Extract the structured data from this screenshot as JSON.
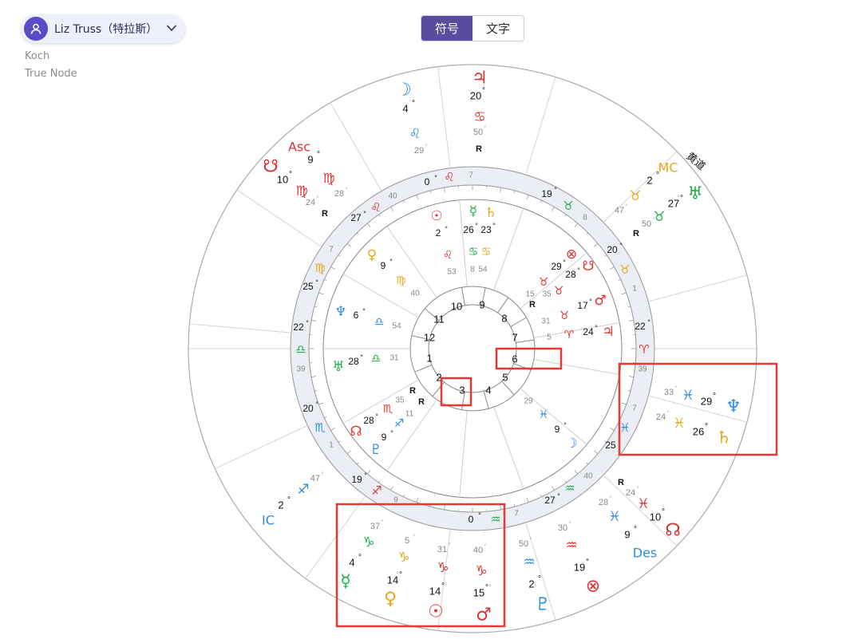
{
  "header": {
    "person_name": "Liz Truss（特拉斯）",
    "house_system": "Koch",
    "node_type": "True Node",
    "toggle": [
      {
        "label": "符号",
        "active": true
      },
      {
        "label": "文字",
        "active": false
      }
    ]
  },
  "chart_labels": {
    "ecliptic": "黄道",
    "house_cusps": [
      "1",
      "2",
      "3",
      "4",
      "5",
      "6",
      "7",
      "8",
      "9",
      "10",
      "11",
      "12"
    ]
  },
  "colors": {
    "fire": "#e03030",
    "earth": "#e8a81a",
    "air": "#1fae4a",
    "water": "#2b8ee0",
    "highlight": "#e53935",
    "accent": "#5a4b9f"
  },
  "outer_planets": [
    {
      "name": "moon",
      "glyph": "☽",
      "deg": "4",
      "sign": "♌",
      "min": "29",
      "color": "#2b8ee0",
      "key": "o1"
    },
    {
      "name": "jupiter",
      "glyph": "♃",
      "deg": "20",
      "sign": "♋",
      "min": "50",
      "color": "#e03030",
      "retro": "R",
      "key": "o2"
    },
    {
      "name": "asc",
      "glyph": "Asc",
      "deg": "9",
      "sign": "♍",
      "min": "28",
      "color": "#e03030",
      "key": "o3"
    },
    {
      "name": "south-node",
      "glyph": "☋",
      "deg": "10",
      "sign": "♍",
      "min": "24",
      "color": "#e03030",
      "retro": "R",
      "key": "o4"
    },
    {
      "name": "mc",
      "glyph": "MC",
      "deg": "2",
      "sign": "♉",
      "min": "47",
      "color": "#e8a81a",
      "key": "o5"
    },
    {
      "name": "uranus",
      "glyph": "♅",
      "deg": "27",
      "sign": "♉",
      "min": "50",
      "color": "#1fae4a",
      "retro": "R",
      "key": "o6"
    },
    {
      "name": "neptune",
      "glyph": "♆",
      "deg": "29",
      "sign": "♓",
      "min": "33",
      "color": "#2b8ee0",
      "key": "o7"
    },
    {
      "name": "saturn",
      "glyph": "♄",
      "deg": "26",
      "sign": "♓",
      "min": "24",
      "color": "#e8a81a",
      "key": "o8"
    },
    {
      "name": "north-node",
      "glyph": "☊",
      "deg": "10",
      "sign": "♓",
      "min": "24",
      "color": "#e03030",
      "retro": "R",
      "key": "o9"
    },
    {
      "name": "des",
      "glyph": "Des",
      "deg": "9",
      "sign": "♓",
      "min": "28",
      "color": "#2b8ee0",
      "key": "o10"
    },
    {
      "name": "part-of-fortune",
      "glyph": "⊗",
      "deg": "19",
      "sign": "♒",
      "min": "30",
      "color": "#e03030",
      "key": "o11"
    },
    {
      "name": "pluto",
      "glyph": "♇",
      "deg": "2",
      "sign": "♒",
      "min": "50",
      "color": "#2b8ee0",
      "key": "o12"
    },
    {
      "name": "mars",
      "glyph": "♂",
      "deg": "15",
      "sign": "♑",
      "min": "40",
      "color": "#e03030",
      "key": "o13"
    },
    {
      "name": "sun",
      "glyph": "☉",
      "deg": "14",
      "sign": "♑",
      "min": "31",
      "color": "#e03030",
      "key": "o14"
    },
    {
      "name": "venus",
      "glyph": "♀",
      "deg": "14",
      "sign": "♑",
      "min": "5",
      "color": "#e8a81a",
      "key": "o15"
    },
    {
      "name": "mercury",
      "glyph": "☿",
      "deg": "4",
      "sign": "♑",
      "min": "37",
      "color": "#1fae4a",
      "key": "o16"
    },
    {
      "name": "ic",
      "glyph": "IC",
      "deg": "2",
      "sign": "♐",
      "min": "47",
      "color": "#2b8ee0",
      "key": "o17"
    }
  ],
  "ring_cusps": [
    {
      "deg": "0",
      "sign": "♌",
      "min": "7",
      "color": "#e03030"
    },
    {
      "deg": "19",
      "sign": "♉",
      "min": "8",
      "color": "#1fae4a"
    },
    {
      "deg": "20",
      "sign": "♉",
      "min": "1",
      "color": "#e8a81a"
    },
    {
      "deg": "22",
      "sign": "♈",
      "min": "39",
      "color": "#e03030"
    },
    {
      "deg": "25",
      "sign": "♓",
      "min": "7",
      "color": "#2b8ee0"
    },
    {
      "deg": "27",
      "sign": "♒",
      "min": "40",
      "color": "#1fae4a"
    },
    {
      "deg": "0",
      "sign": "♒",
      "min": "7",
      "color": "#1fae4a"
    },
    {
      "deg": "19",
      "sign": "♐",
      "min": "9",
      "color": "#e03030"
    },
    {
      "deg": "20",
      "sign": "♏",
      "min": "1",
      "color": "#2b8ee0"
    },
    {
      "deg": "22",
      "sign": "♎",
      "min": "39",
      "color": "#1fae4a"
    },
    {
      "deg": "25",
      "sign": "♍",
      "min": "7",
      "color": "#e8a81a"
    },
    {
      "deg": "27",
      "sign": "♌",
      "min": "40",
      "color": "#e03030"
    }
  ],
  "inner_planets": [
    {
      "name": "sun",
      "glyph": "☉",
      "deg": "2",
      "sign": "♌",
      "min": "53",
      "color": "#e03030"
    },
    {
      "name": "mercury",
      "glyph": "☿",
      "deg": "26",
      "sign": "♋",
      "min": "8",
      "color": "#1fae4a"
    },
    {
      "name": "saturn",
      "glyph": "♄",
      "deg": "23",
      "sign": "♋",
      "min": "54",
      "color": "#e8a81a"
    },
    {
      "name": "venus",
      "glyph": "♀",
      "deg": "9",
      "sign": "♍",
      "min": "40",
      "color": "#e8a81a"
    },
    {
      "name": "neptune",
      "glyph": "♆",
      "deg": "6",
      "sign": "♎",
      "min": "54",
      "color": "#2b8ee0"
    },
    {
      "name": "uranus",
      "glyph": "♅",
      "deg": "28",
      "sign": "♎",
      "min": "31",
      "color": "#1fae4a"
    },
    {
      "name": "part-of-fortune",
      "glyph": "⊗",
      "deg": "29",
      "sign": "♉",
      "min": "15",
      "color": "#e03030"
    },
    {
      "name": "south-node",
      "glyph": "☋",
      "deg": "28",
      "sign": "♉",
      "min": "35",
      "color": "#e03030",
      "retro": "R"
    },
    {
      "name": "mars",
      "glyph": "♂",
      "deg": "17",
      "sign": "♉",
      "min": "31",
      "color": "#e03030"
    },
    {
      "name": "jupiter",
      "glyph": "♃",
      "deg": "24",
      "sign": "♈",
      "min": "5",
      "color": "#e03030"
    },
    {
      "name": "north-node",
      "glyph": "☊",
      "deg": "28",
      "sign": "♏",
      "min": "35",
      "color": "#e03030",
      "retro": "R"
    },
    {
      "name": "pluto",
      "glyph": "♇",
      "deg": "9",
      "sign": "♐",
      "min": "11",
      "color": "#2b8ee0",
      "retro": "R"
    },
    {
      "name": "moon",
      "glyph": "☽",
      "deg": "9",
      "sign": "♓",
      "min": "29",
      "color": "#2b8ee0"
    }
  ]
}
